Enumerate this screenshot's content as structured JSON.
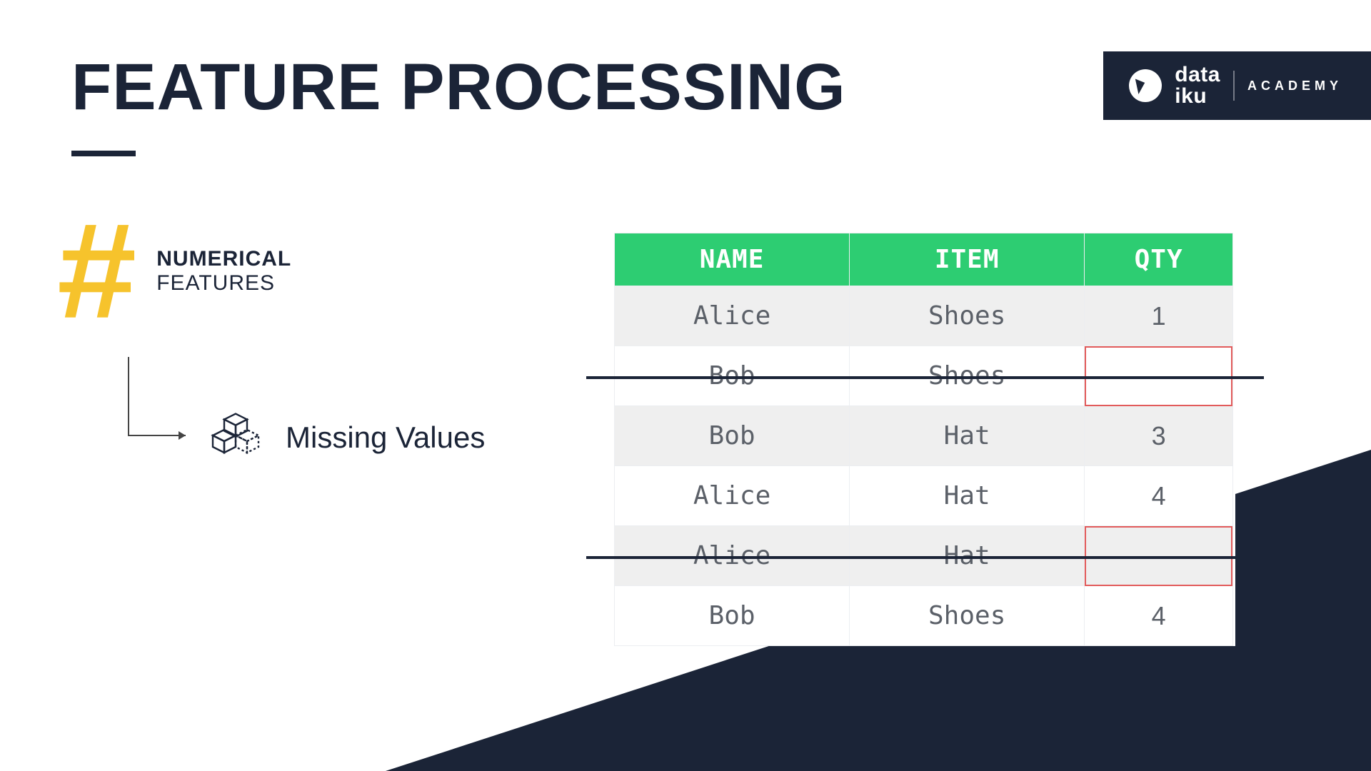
{
  "brand": {
    "line1": "data",
    "line2": "iku",
    "academy": "ACADEMY"
  },
  "title": "FEATURE PROCESSING",
  "hash": {
    "glyph": "#",
    "label_top": "NUMERICAL",
    "label_bottom": "FEATURES"
  },
  "missing_values_label": "Missing Values",
  "table": {
    "headers": [
      "NAME",
      "ITEM",
      "QTY"
    ],
    "rows": [
      {
        "name": "Alice",
        "item": "Shoes",
        "qty": "1",
        "struck": false,
        "missing": false
      },
      {
        "name": "Bob",
        "item": "Shoes",
        "qty": "",
        "struck": true,
        "missing": true
      },
      {
        "name": "Bob",
        "item": "Hat",
        "qty": "3",
        "struck": false,
        "missing": false
      },
      {
        "name": "Alice",
        "item": "Hat",
        "qty": "4",
        "struck": false,
        "missing": false
      },
      {
        "name": "Alice",
        "item": "Hat",
        "qty": "",
        "struck": true,
        "missing": true
      },
      {
        "name": "Bob",
        "item": "Shoes",
        "qty": "4",
        "struck": false,
        "missing": false
      }
    ]
  }
}
